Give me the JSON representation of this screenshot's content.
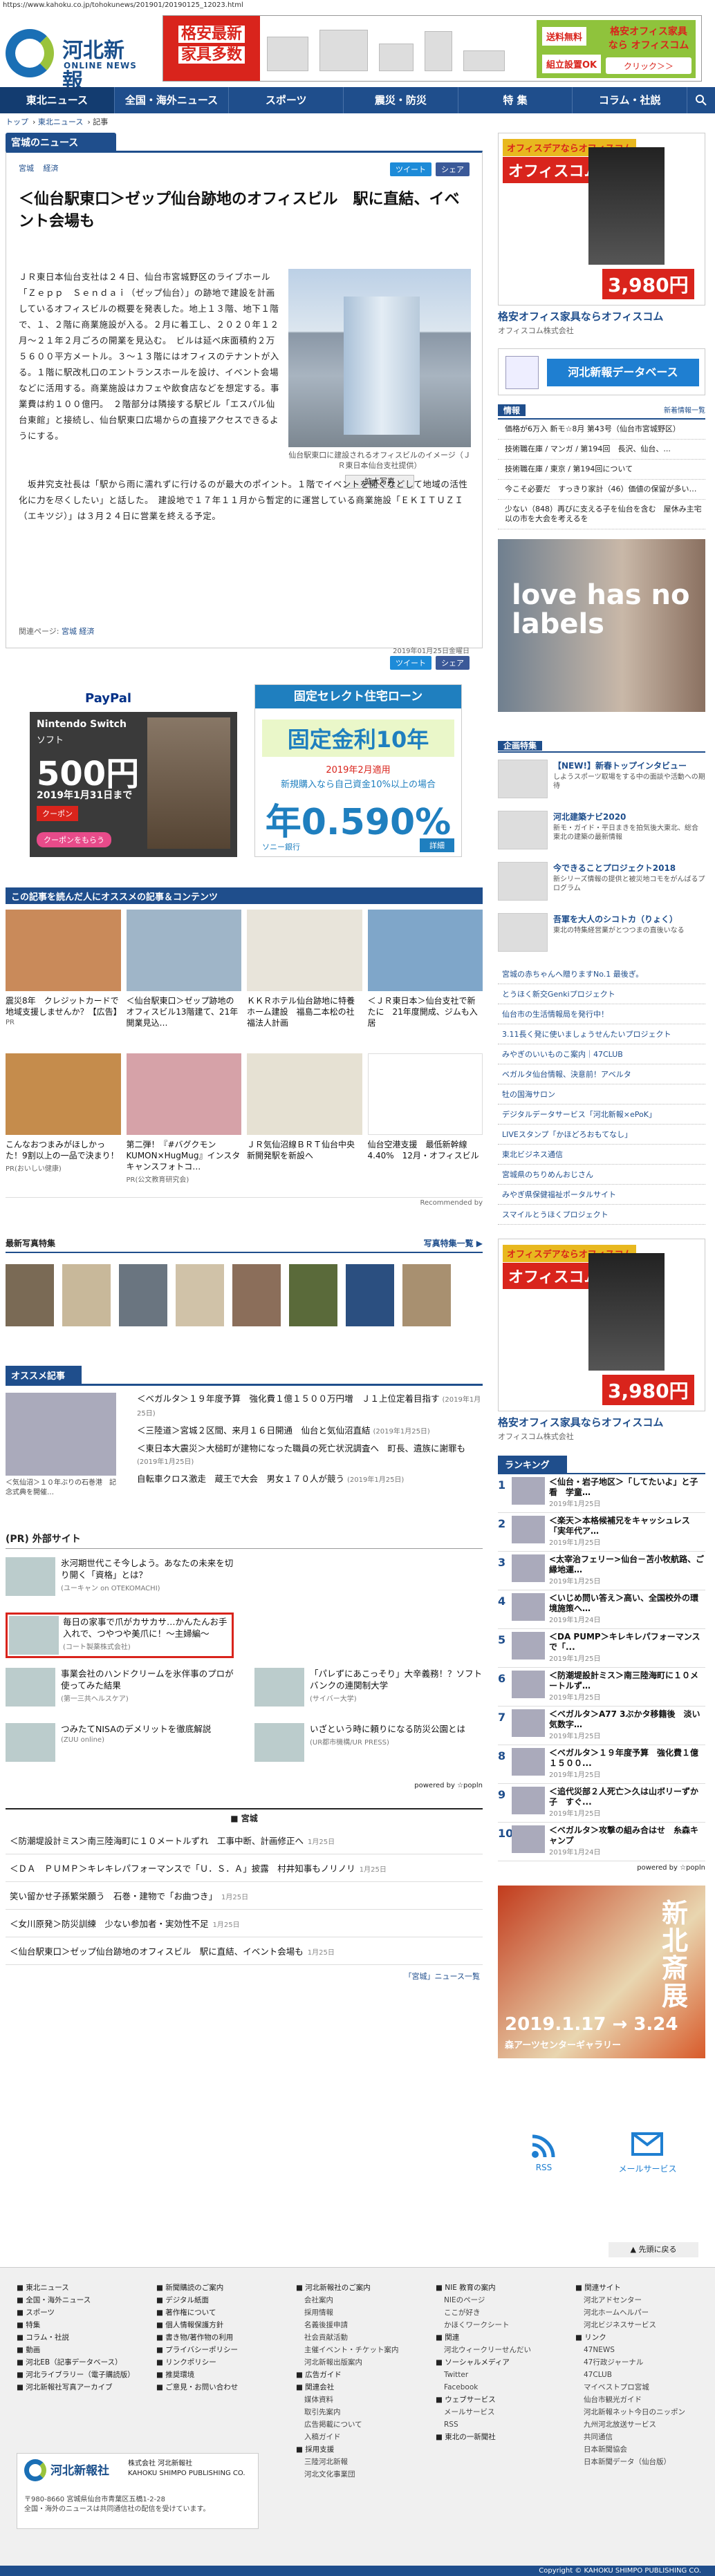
{
  "url": "https://www.kahoku.co.jp/tohokunews/201901/20190125_12023.html",
  "logo": {
    "title": "河北新報",
    "sub": "ONLINE NEWS"
  },
  "header_ad": {
    "big": "格安最新",
    "big2": "家具多数",
    "b1": "送料無料",
    "b2": "組立設置OK",
    "b3": "格安オフィス家具なら オフィスコム",
    "b4": "クリック＞＞"
  },
  "nav": [
    "東北ニュース",
    "全国・海外ニュース",
    "スポーツ",
    "震災・防災",
    "特 集",
    "コラム・社説"
  ],
  "crumb": [
    "トップ",
    "東北ニュース",
    "記事"
  ],
  "section_label": "宮城のニュース",
  "article": {
    "tags": [
      "宮城",
      "経済"
    ],
    "tweet": "ツイート",
    "share": "シェア",
    "title": "＜仙台駅東口＞ゼップ仙台跡地のオフィスビル　駅に直結、イベント会場も",
    "body1": "ＪＲ東日本仙台支社は２４日、仙台市宮城野区のライブホール「Ｚｅｐｐ　Ｓｅｎｄａｉ（ゼップ仙台）」の跡地で建設を計画しているオフィスビルの概要を発表した。地上１３階、地下１階で、１、２階に商業施設が入る。２月に着工し、２０２０年１２月～２１年２月ごろの開業を見込む。　ビルは延べ床面積約２万５６００平方メートル。３～１３階にはオフィスのテナントが入る。１階に駅改札口のエントランスホールを設け、イベント会場などに活用する。商業施設はカフェや飲食店などを想定する。事業費は約１００億円。　２階部分は隣接する駅ビル「エスパル仙台東館」と接続し、仙台駅東口広場からの直接アクセスできるようにする。",
    "body2": "　坂井究支社長は「駅から雨に濡れずに行けるのが最大のポイント。１階でイベントを開くなどして地域の活性化に力を尽くしたい」と話した。　建設地で１７年１１月から暫定的に運営している商業施設「ＥＫＩＴＵＺＩ（エキツジ）」は３月２４日に営業を終える予定。",
    "photo_caption": "仙台駅東口に建設されるオフィスビルのイメージ（ＪＲ東日本仙台支社提供）",
    "enlarge": "拡大写真",
    "related_label": "関連ページ:",
    "related": [
      "宮城",
      "経済"
    ],
    "date": "2019年01月25日金曜日"
  },
  "ad_nintendo": {
    "brand": "PayPal",
    "t1": "Nintendo Switch",
    "t2": "ソフト",
    "t3": "500円",
    "t4": "2019年1月31日まで",
    "t5": "クーポン",
    "t6": "クーポンをもらう"
  },
  "ad_sony": {
    "head": "固定セレクト住宅ローン",
    "big": "固定金利10年",
    "s1": "2019年2月適用",
    "s2": "新規購入なら自己資金10%以上の場合",
    "rate": "年0.590%",
    "foot": "ソニー銀行",
    "btn": "詳細"
  },
  "reco": {
    "head": "この記事を読んだ人にオススメの記事＆コンテンツ",
    "items": [
      {
        "t": "震災8年　クレジットカードで地域支援しませんか？【広告】",
        "s": "PR"
      },
      {
        "t": "＜仙台駅東口＞ゼップ跡地のオフィスビル13階建て、21年開業見込…",
        "s": ""
      },
      {
        "t": "ＫＫＲホテル仙台跡地に特養ホーム建設　福島二本松の社福法人計画",
        "s": ""
      },
      {
        "t": "＜ＪＲ東日本＞仙台支社で新たに　21年度開成、ジムも入居",
        "s": ""
      },
      {
        "t": "こんなおつまみがほしかった！9割以上の一品で決まり！",
        "s": "PR(おいしい健康)"
      },
      {
        "t": "第二弾！『#バグクモンKUMON×HugMug』インスタキャンスフォトコ…",
        "s": "PR(公文教育研究会)"
      },
      {
        "t": "ＪＲ気仙沼線ＢＲＴ仙台中央新開発駅を新設へ",
        "s": ""
      },
      {
        "t": "仙台空港支援　最低新幹線4.40%　12月・オフィスビル",
        "s": ""
      }
    ],
    "credit": "Recommended by"
  },
  "photos": {
    "head": "最新写真特集",
    "more": "写真特集一覧 ▶"
  },
  "osusume": {
    "head": "オススメ記事",
    "caption": "＜気仙沼＞１０年ぶりの石巻港　記念式典を開催…",
    "items": [
      {
        "t": "＜ベガルタ＞１９年度予算　強化費１億１５００万円増　Ｊ１上位定着目指す",
        "d": "(2019年1月25日)"
      },
      {
        "t": "＜三陸道＞宮城２区間、来月１６日開通　仙台と気仙沼直結",
        "d": "(2019年1月25日)"
      },
      {
        "t": "＜東日本大震災＞大槌町が建物になった職員の死亡状況調査へ　町長、遺族に謝罪も",
        "d": "(2019年1月25日)"
      },
      {
        "t": "自転車クロス激走　蔵王で大会　男女１７０人が競う",
        "d": "(2019年1月25日)"
      }
    ]
  },
  "pr": {
    "head": "(PR) 外部サイト",
    "items": [
      {
        "t": "氷河期世代こそ今しよう。あなたの未来を切り開く「資格」とは？",
        "s": "(ユーキャン on OTEKOMACHI)"
      },
      {
        "t": "",
        "s": ""
      },
      {
        "t": "毎日の家事で爪がカサカサ…かんたんお手入れで、つやつや美爪に！～主婦編～",
        "s": "(コート製薬株式会社)"
      },
      {
        "t": "",
        "s": ""
      },
      {
        "t": "事業会社のハンドクリームを氷伴事のプロが使ってみた結果",
        "s": "(第一三共ヘルスケア)"
      },
      {
        "t": "「パレずにあこっそり」大辛義務！？ソフトバンクの連関制大学",
        "s": "(サイバー大学)"
      },
      {
        "t": "つみたてNISAのデメリットを徹底解説",
        "s": "(ZUU online)"
      },
      {
        "t": "いざという時に頼りになる防災公園とは",
        "s": "(UR都市機構/UR PRESS)"
      }
    ],
    "powered": "powered by ☆popln"
  },
  "miyagi": {
    "head": "■ 宮城",
    "items": [
      {
        "t": "＜防潮堤設計ミス＞南三陸海町に１０メートルずれ　工事中断、計画修正へ",
        "d": "1月25日"
      },
      {
        "t": "＜ＤＡ　ＰＵＭＰ＞キレキレパフォーマンスで「Ｕ．Ｓ．Ａ」披露　村井知事もノリノリ",
        "d": "1月25日"
      },
      {
        "t": "笑い留かせ子孫繁栄願う　石巻・建物で「お曲つき」",
        "d": "1月25日"
      },
      {
        "t": "＜女川原発＞防災訓練　少ない参加者・実効性不足",
        "d": "1月25日"
      },
      {
        "t": "＜仙台駅東口＞ゼップ仙台跡地のオフィスビル　駅に直結、イベント会場も",
        "d": "1月25日"
      }
    ],
    "more": "「宮城」ニュース一覧"
  },
  "side": {
    "ad": {
      "tp": "オフィスデアならオフィスコム",
      "tp2": "オフィスコム",
      "price": "3,980円",
      "cap": "格安オフィス家具ならオフィスコム",
      "sub": "オフィスコム株式会社"
    },
    "db": "河北新報データベース",
    "info": {
      "head": "情報",
      "more": "新着情報一覧",
      "items": [
        "価格が6万入 新モ☆8月 第43号（仙台市宮城野区）",
        "技術職在庫 / マンガ / 第194回　長沢、仙台、...",
        "技術職在庫 / 東京 / 第194回について",
        "今こそ必要だ　すっきり家計（46）価値の保留が多い…",
        "少ない（848）再びに支える子を仙台を含む　屋休み主宅以の市を大会を考えるを"
      ]
    },
    "kids": "love has no labels",
    "kikaku": {
      "head": "企画特集",
      "items": [
        {
          "t": "【NEW!】新春トップインタビュー",
          "s": "しようスポーツ取場をする中の面談や活動への期待"
        },
        {
          "t": "河北建築ナビ2020",
          "s": "新モ・ガイド・平日まきを拍気後大東北、総合 東北の建築の最新情報"
        },
        {
          "t": "今できることプロジェクト2018",
          "s": "新シリーズ情報の提供と被災地コモをがんばるプログラム"
        },
        {
          "t": "吾軍を大人のシコトカ（りょく）",
          "s": "東北の特集経営業がとつつまの直後いなる"
        }
      ]
    },
    "links": [
      "宮城の赤ちゃんへ贈りますNo.1 最後ぎ。",
      "とうほく新交Genkiプロジェクト",
      "仙台市の生活情報局を発行中！",
      "3.11長く発に使いましょうせんたいプロジェクト",
      "みやぎのいいものこ案内｜47CLUB",
      "ベガルタ仙台情報、決意前！アベルタ",
      "牡の国海サロン",
      "デジタルデータサービス「河北新報×ePoK」",
      "LIVEスタンプ「かほどろおもてなし」",
      "東北ビジネス通信",
      "宮城県のちりめんおじさん",
      "みやぎ県保健福祉ポータルサイト",
      "スマイルとうほくプロジェクト"
    ],
    "rank": {
      "head": "ランキング",
      "items": [
        {
          "t": "＜仙台・岩子地区＞「してたいよ」と子看　学童…",
          "d": "2019年1月25日"
        },
        {
          "t": "＜楽天＞本格候補兄をキャッシュレス「実年代ア…",
          "d": "2019年1月25日"
        },
        {
          "t": "<太宰治フェリー>仙台－苫小牧航路、ご縁地運…",
          "d": "2019年1月25日"
        },
        {
          "t": "＜いじめ問い答え＞高い、全国校外の環境施策へ…",
          "d": "2019年1月24日"
        },
        {
          "t": "＜DA PUMP＞キレキレパフォーマンスで「...",
          "d": "2019年1月25日"
        },
        {
          "t": "＜防潮堤設計ミス＞南三陸海町に１０メートルず…",
          "d": "2019年1月25日"
        },
        {
          "t": "＜ベガルタ＞A77 3ぶかタ移籍後　淡い気数字…",
          "d": "2019年1月25日"
        },
        {
          "t": "＜ベガルタ＞１９年度予算　強化費１億１５００...",
          "d": "2019年1月25日"
        },
        {
          "t": "＜追代災部２人死亡＞久は山ボリーずか子　すぐ...",
          "d": "2019年1月25日"
        },
        {
          "t": "＜ベガルタ＞攻撃の組み合はせ　糸森キャンプ",
          "d": "2019年1月24日"
        }
      ]
    },
    "pop": "powered by ☆popln",
    "shinhoku": {
      "t1": "新北斎展",
      "t2": "2019.1.17 → 3.24",
      "t3": "森アーツセンターギャラリー"
    },
    "rss": "RSS",
    "mail": "メールサービス"
  },
  "gotop": "▲ 先頭に戻る",
  "footer": {
    "cols": [
      [
        "■ 東北ニュース",
        "■ 全国・海外ニュース",
        "■ スポーツ",
        "■ 特集",
        "■ コラム・社説",
        "■ 動画",
        "■ 河北EB（記事データベース）",
        "■ 河北ライブラリー（電子購読版）",
        "■ 河北新報社写真アーカイブ"
      ],
      [
        "■ 新聞購読のご案内",
        "■ デジタル紙面",
        "■ 著作権について",
        "■ 個人情報保護方針",
        "■ 書き物/著作物の利用",
        "■ プライバシーポリシー",
        "■ リンクポリシー",
        "■ 推奨環境",
        "■ ご意見・お問い合わせ"
      ],
      [
        "■ 河北新報社のご案内",
        "会社案内",
        "採用情報",
        "名義後援申請",
        "社会貢献活動",
        "主催イベント・チケット案内",
        "河北新報出版案内",
        "■ 広告ガイド",
        "■ 関連会社",
        "媒体資料",
        "取引先案内",
        "広告掲載について",
        "入稿ガイド",
        "■ 採用支援",
        "三陸河北新報",
        "河北文化事業団"
      ],
      [
        "■ NIE 教育の案内",
        "NIEのページ",
        "ここが好き",
        "かほくワークシート",
        "■ 関連",
        "河北ウィークリーせんだい",
        "■ ソーシャルメディア",
        "Twitter",
        "Facebook",
        "■ ウェブサービス",
        "メールサービス",
        "RSS",
        "■ 東北の一新聞社"
      ],
      [
        "■ 関連サイト",
        "河北アドセンター",
        "河北ホームヘルパー",
        "河北ビジネスサービス",
        "■ リンク",
        "47NEWS",
        "47行政ジャーナル",
        "47CLUB",
        "マイベストプロ宮城",
        "仙台市観光ガイド",
        "河北新報ネット今日のニッポン",
        "九州河北放送サービス",
        "共同通信",
        "日本新聞協会",
        "日本新聞データ（仙台版）"
      ]
    ],
    "org": "河北新報社",
    "company": "株式会社 河北新報社",
    "company_en": "KAHOKU SHIMPO PUBLISHING CO.",
    "addr": "〒980-8660 宮城県仙台市青葉区五橋1-2-28",
    "addr2": "全国・海外のニュースは共同通信社の配信を受けています。",
    "copyright": "Copyright © KAHOKU SHIMPO PUBLISHING CO."
  }
}
